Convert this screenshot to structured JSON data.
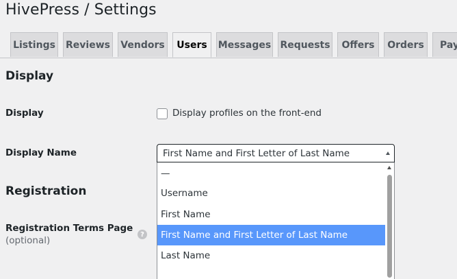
{
  "header": {
    "title": "HivePress / Settings"
  },
  "tabs": [
    {
      "label": "Listings",
      "active": false
    },
    {
      "label": "Reviews",
      "active": false
    },
    {
      "label": "Vendors",
      "active": false
    },
    {
      "label": "Users",
      "active": true
    },
    {
      "label": "Messages",
      "active": false
    },
    {
      "label": "Requests",
      "active": false
    },
    {
      "label": "Offers",
      "active": false
    },
    {
      "label": "Orders",
      "active": false
    },
    {
      "label": "Paye",
      "active": false
    }
  ],
  "display_section": {
    "title": "Display",
    "display_field": {
      "label": "Display",
      "checkbox_label": "Display profiles on the front-end",
      "checked": false
    },
    "display_name_field": {
      "label": "Display Name",
      "selected_value": "First Name and First Letter of Last Name",
      "options": [
        {
          "label": "—",
          "selected": false
        },
        {
          "label": "Username",
          "selected": false
        },
        {
          "label": "First Name",
          "selected": false
        },
        {
          "label": "First Name and First Letter of Last Name",
          "selected": true
        },
        {
          "label": "Last Name",
          "selected": false
        }
      ]
    }
  },
  "registration_section": {
    "title": "Registration",
    "terms_field": {
      "label": "Registration Terms Page",
      "hint": "(optional)",
      "help_icon": "question-circle-icon"
    }
  },
  "colors": {
    "highlight": "#5897fb",
    "background": "#f0f0f1",
    "tab_inactive": "#dcdcde"
  }
}
